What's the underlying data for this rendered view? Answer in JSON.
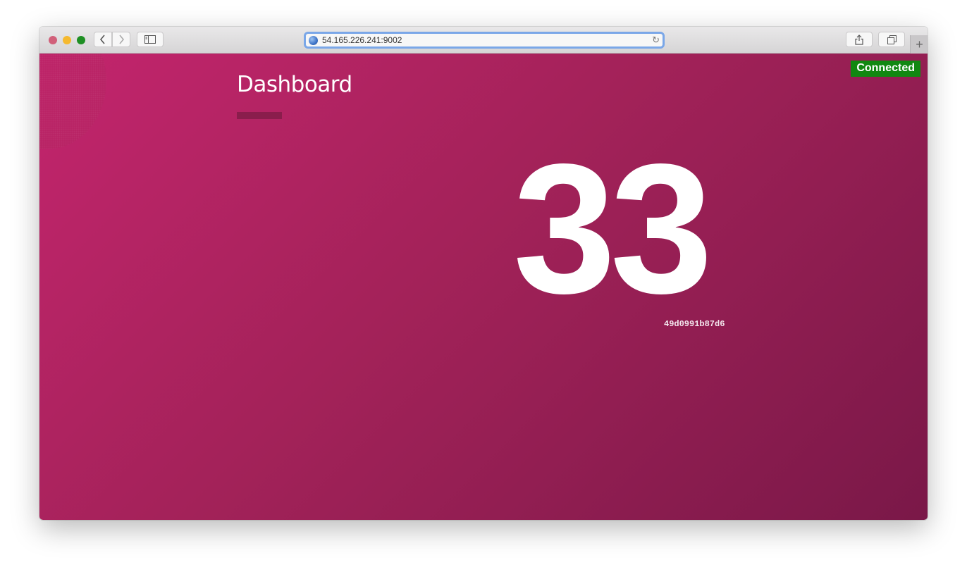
{
  "browser": {
    "url": "54.165.226.241:9002",
    "buttons": {
      "back": "‹",
      "forward": "›",
      "new_tab": "+"
    },
    "icons": {
      "sidebar": "sidebar-icon",
      "share": "share-icon",
      "tabs": "tabs-overview-icon",
      "reload": "reload-icon",
      "globe": "globe-icon"
    }
  },
  "page": {
    "title": "Dashboard",
    "status": "Connected",
    "status_color": "#118811",
    "counter": "33",
    "hostname": "49d0991b87d6",
    "accent_color": "#c3256d"
  }
}
